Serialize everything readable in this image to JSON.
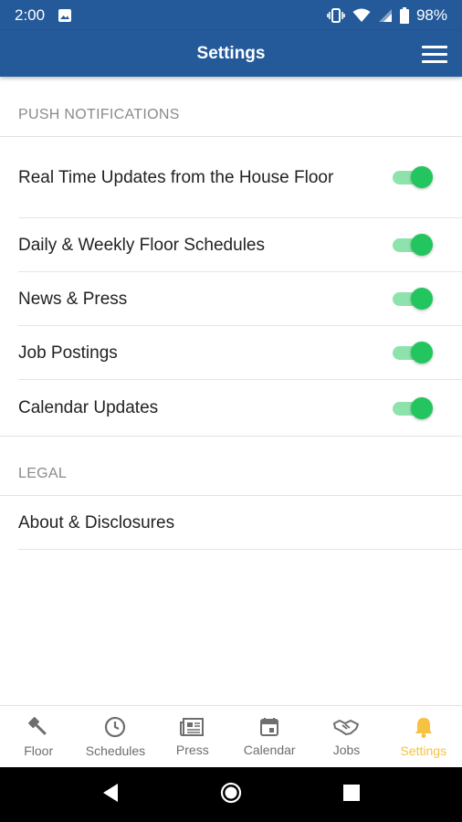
{
  "status_bar": {
    "time": "2:00",
    "battery": "98%"
  },
  "app_bar": {
    "title": "Settings"
  },
  "sections": {
    "push": {
      "title": "PUSH NOTIFICATIONS",
      "items": [
        {
          "label": "Real Time Updates from the House Floor",
          "enabled": true
        },
        {
          "label": "Daily & Weekly Floor Schedules",
          "enabled": true
        },
        {
          "label": "News & Press",
          "enabled": true
        },
        {
          "label": "Job Postings",
          "enabled": true
        },
        {
          "label": "Calendar Updates",
          "enabled": true
        }
      ]
    },
    "legal": {
      "title": "LEGAL",
      "items": [
        {
          "label": "About & Disclosures"
        }
      ]
    }
  },
  "bottom_nav": {
    "items": [
      {
        "label": "Floor",
        "icon": "gavel-icon"
      },
      {
        "label": "Schedules",
        "icon": "clock-icon"
      },
      {
        "label": "Press",
        "icon": "newspaper-icon"
      },
      {
        "label": "Calendar",
        "icon": "calendar-icon"
      },
      {
        "label": "Jobs",
        "icon": "handshake-icon"
      },
      {
        "label": "Settings",
        "icon": "bell-icon"
      }
    ],
    "active_color": "#f5c242"
  },
  "colors": {
    "header": "#245a9a",
    "toggle_on": "#22c55e"
  }
}
